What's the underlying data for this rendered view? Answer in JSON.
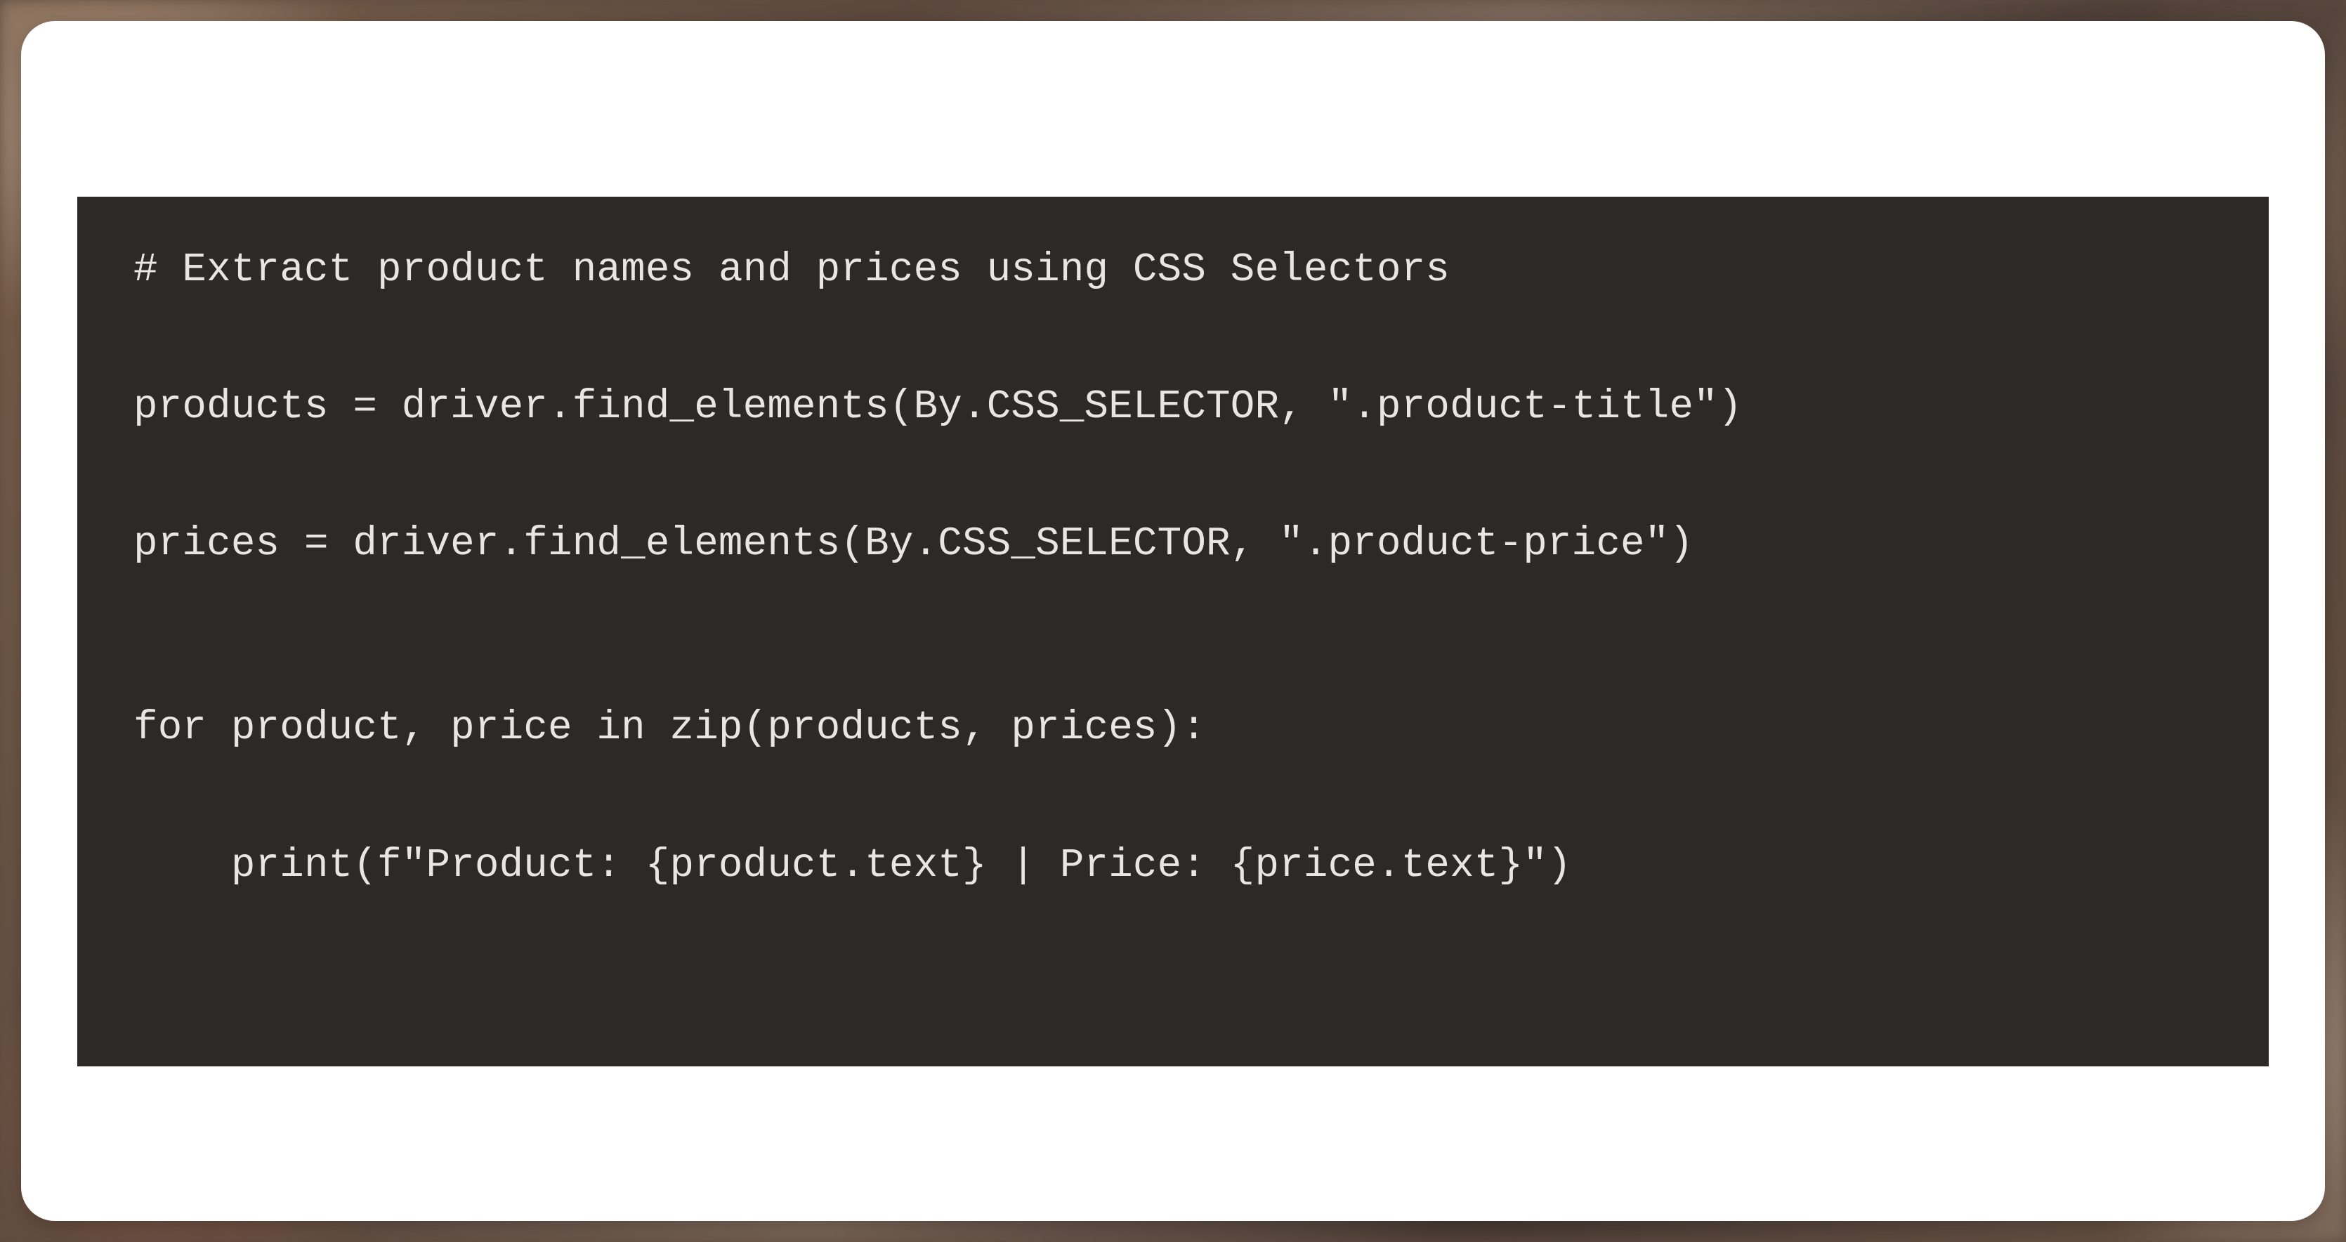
{
  "code": {
    "line1": "# Extract product names and prices using CSS Selectors",
    "line2": "products = driver.find_elements(By.CSS_SELECTOR, \".product-title\")",
    "line3": "prices = driver.find_elements(By.CSS_SELECTOR, \".product-price\")",
    "line4": "for product, price in zip(products, prices):",
    "line5": "    print(f\"Product: {product.text} | Price: {price.text}\")"
  }
}
